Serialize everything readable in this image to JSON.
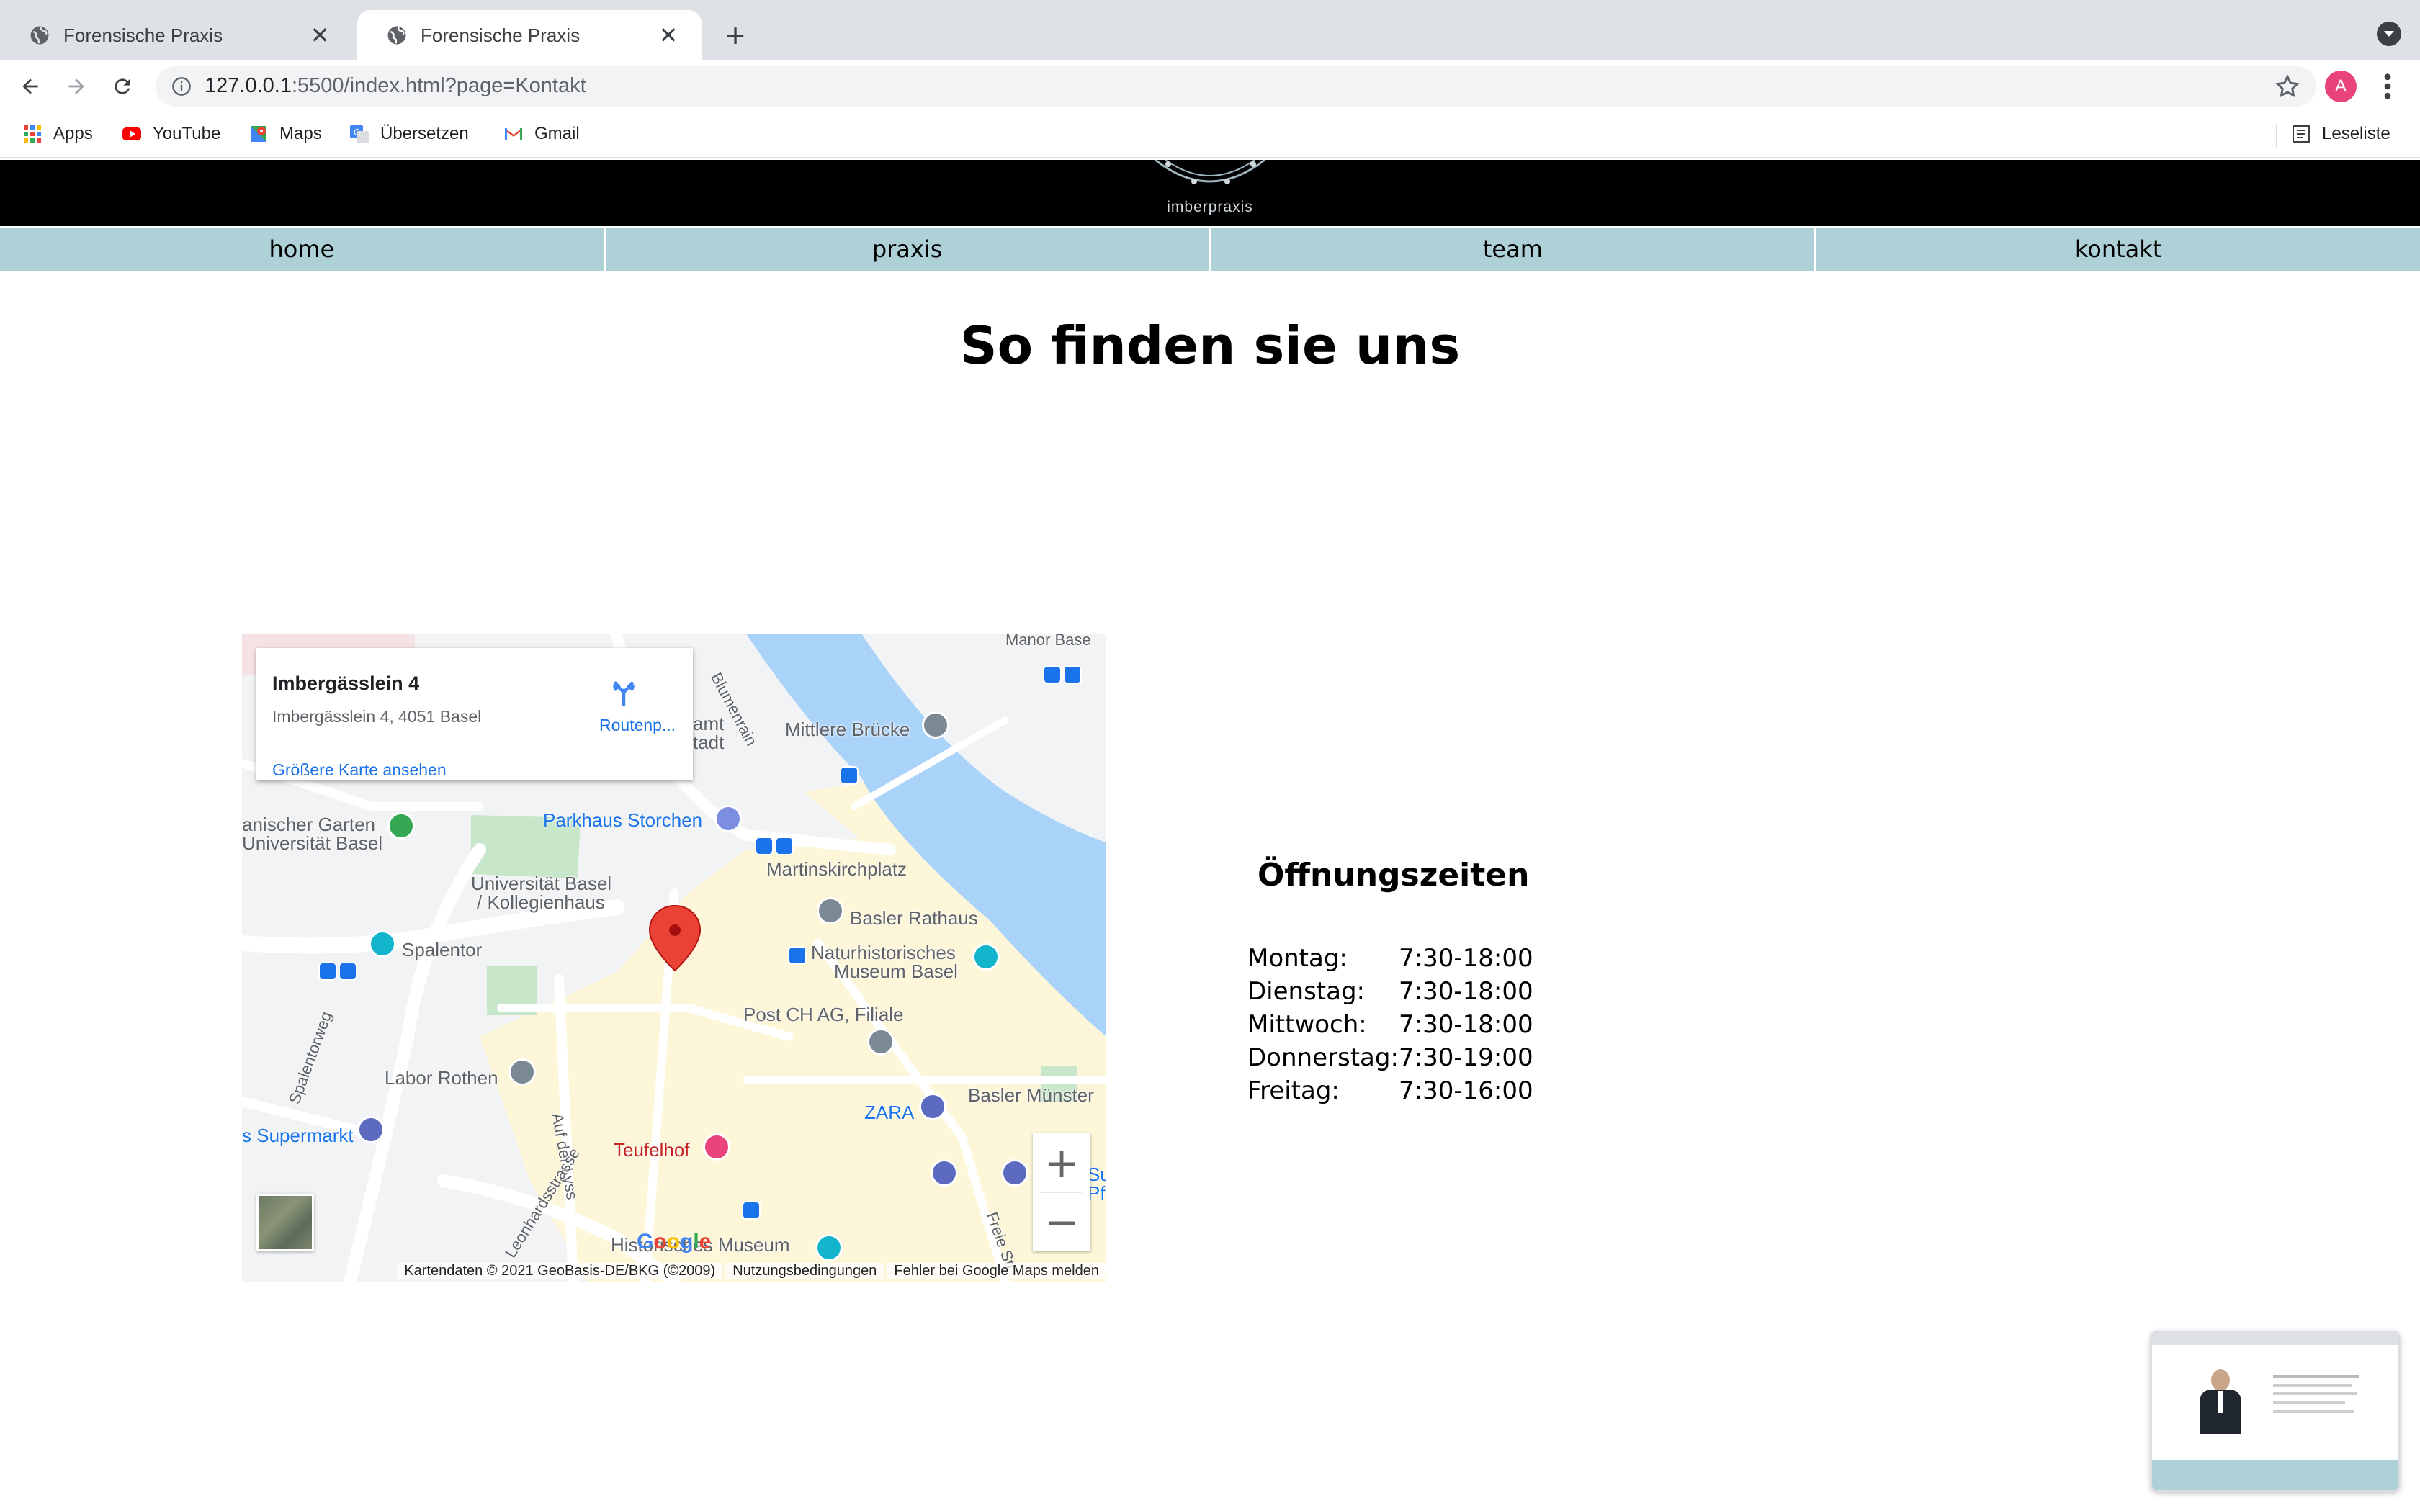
{
  "browser": {
    "tabs": [
      {
        "title": "Forensische Praxis",
        "active": false
      },
      {
        "title": "Forensische Praxis",
        "active": true
      }
    ],
    "url_host": "127.0.0.1",
    "url_rest": ":5500/index.html?page=Kontakt",
    "profile_initial": "A",
    "bookmarks": [
      {
        "label": "Apps",
        "icon": "apps-grid-icon"
      },
      {
        "label": "YouTube",
        "icon": "youtube-icon"
      },
      {
        "label": "Maps",
        "icon": "maps-icon"
      },
      {
        "label": "Übersetzen",
        "icon": "translate-icon"
      },
      {
        "label": "Gmail",
        "icon": "gmail-icon"
      }
    ],
    "reading_list": "Leseliste"
  },
  "site": {
    "logo_text": "imberpraxis",
    "nav": [
      "home",
      "praxis",
      "team",
      "kontakt"
    ],
    "headline": "So finden sie uns"
  },
  "map": {
    "card": {
      "title": "Imbergässlein 4",
      "address": "Imbergässlein 4, 4051 Basel",
      "larger_map": "Größere Karte ansehen",
      "directions": "Routenp..."
    },
    "labels": {
      "manor": "Manor Base",
      "mittlere_bruecke": "Mittlere Brücke",
      "amt": "amt",
      "tadt": "tadt",
      "blumenrain": "Blumenrain",
      "garten": "anischer Garten",
      "uni_basel_1": "Universität Basel",
      "parkhaus": "Parkhaus Storchen",
      "martinskirchplatz": "Martinskirchplatz",
      "uni_koll_1": "Universität Basel",
      "uni_koll_2": "/ Kollegienhaus",
      "basler_rathaus": "Basler Rathaus",
      "spalentor": "Spalentor",
      "naturhist_1": "Naturhistorisches",
      "naturhist_2": "Museum Basel",
      "post": "Post CH AG, Filiale",
      "spalentorweg": "Spalentorweg",
      "labor_rothen": "Labor Rothen",
      "zara": "ZARA",
      "basler_muenster": "Basler Münster",
      "supermarkt": "s Supermarkt",
      "auf_der_lyss": "Auf der Lyss",
      "teufelhof": "Teufelhof",
      "histor_museum": "Historisches Museum",
      "leonhardsstrasse": "Leonhardsstrasse",
      "freie_str": "Freie Str",
      "su": "Su",
      "pf": "Pf"
    },
    "zoom_in": "+",
    "zoom_out": "−",
    "attribution": [
      "Kartendaten © 2021 GeoBasis-DE/BKG (©2009)",
      "Nutzungsbedingungen",
      "Fehler bei Google Maps melden"
    ],
    "google_logo": "Google"
  },
  "hours": {
    "title": "Öffnungszeiten",
    "rows": [
      {
        "day": "Montag:",
        "time": "7:30-18:00"
      },
      {
        "day": "Dienstag:",
        "time": "7:30-18:00"
      },
      {
        "day": "Mittwoch:",
        "time": "7:30-18:00"
      },
      {
        "day": "Donnerstag:",
        "time": "7:30-19:00"
      },
      {
        "day": "Freitag:",
        "time": "7:30-16:00"
      }
    ]
  },
  "colors": {
    "nav_bg": "#aed0d7",
    "header_bg": "#000000",
    "water": "#aad3f9",
    "oldtown": "#fdf6d8",
    "marker": "#ea4335"
  }
}
